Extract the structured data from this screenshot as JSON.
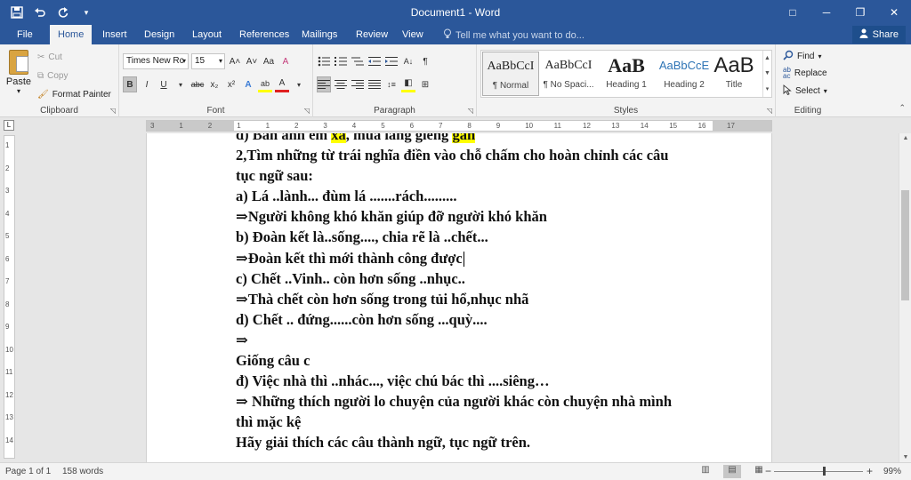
{
  "app": {
    "title": "Document1 - Word",
    "icons": {
      "save": "save-icon",
      "undo": "undo-icon",
      "redo": "redo-icon",
      "customize": "customize-qat-icon"
    }
  },
  "window": {
    "ribbon_display": "□",
    "minimize": "─",
    "restore": "❐",
    "close": "✕"
  },
  "tabs": [
    "File",
    "Home",
    "Insert",
    "Design",
    "Layout",
    "References",
    "Mailings",
    "Review",
    "View"
  ],
  "tell_me": "Tell me what you want to do...",
  "share": "Share",
  "ribbon": {
    "clipboard": {
      "paste": "Paste",
      "cut": "Cut",
      "copy": "Copy",
      "format_painter": "Format Painter",
      "label": "Clipboard"
    },
    "font": {
      "name": "Times New Rc",
      "size": "15",
      "grow": "A˄",
      "shrink": "A˅",
      "case": "Aa",
      "clear": "A",
      "bold": "B",
      "italic": "I",
      "underline": "U",
      "strike": "abc",
      "sub": "x₂",
      "sup": "x²",
      "effects": "A",
      "highlight": "ab",
      "color": "A",
      "label": "Font"
    },
    "paragraph": {
      "label": "Paragraph",
      "pilcrow": "¶"
    },
    "styles": {
      "label": "Styles",
      "items": [
        {
          "preview": "AaBbCcI",
          "name": "¶ Normal"
        },
        {
          "preview": "AaBbCcI",
          "name": "¶ No Spaci..."
        },
        {
          "preview": "AaB",
          "name": "Heading 1"
        },
        {
          "preview": "AaBbCcE",
          "name": "Heading 2"
        },
        {
          "preview": "AaB",
          "name": "Title"
        }
      ]
    },
    "editing": {
      "label": "Editing",
      "find": "Find",
      "replace": "Replace",
      "select": "Select"
    }
  },
  "ruler": {
    "ticks": [
      "3",
      "1",
      "2",
      "1",
      "1",
      "2",
      "3",
      "4",
      "5",
      "6",
      "7",
      "8",
      "9",
      "10",
      "11",
      "12",
      "13",
      "14",
      "15",
      "16",
      "17"
    ]
  },
  "vruler": {
    "ticks": [
      "1",
      "2",
      "3",
      "4",
      "5",
      "6",
      "7",
      "8",
      "9",
      "10",
      "11",
      "12",
      "13",
      "14"
    ]
  },
  "document": {
    "lines": [
      {
        "pre": "d) Bán anh em ",
        "hl": "xa",
        "post": ", mua láng giềng ",
        "hl2": "gần"
      },
      {
        "text": " 2,Tìm những từ trái nghĩa điền vào chỗ chấm cho hoàn chỉnh các câu"
      },
      {
        "text": "tục ngữ sau:"
      },
      {
        "text": "a) Lá ..lành... đùm lá .......rách........."
      },
      {
        "text": "⇒Người không khó khăn giúp đỡ người khó khăn"
      },
      {
        "text": "b) Đoàn kết là..sống...., chia rẽ là ..chết..."
      },
      {
        "text": "⇒Đoàn kết thì mới thành công được",
        "caret": true
      },
      {
        "text": "c) Chết ..Vinh.. còn hơn sống ..nhục.."
      },
      {
        "text": "⇒Thà chết còn hơn sống trong tủi hổ,nhục nhã"
      },
      {
        "text": " d) Chết .. đứng......còn hơn sống ...quỳ...."
      },
      {
        "text": "⇒"
      },
      {
        "text": "Giống câu c"
      },
      {
        "text": "đ) Việc nhà thì ..nhác..., việc chú bác thì ....siêng…"
      },
      {
        "text": "⇒ Những thích người lo chuyện của người khác còn chuyện nhà mình"
      },
      {
        "text": "thì mặc kệ"
      },
      {
        "text": "Hãy giải thích các câu thành ngữ, tục ngữ trên."
      }
    ]
  },
  "status": {
    "page": "Page 1 of 1",
    "words": "158 words",
    "zoom_minus": "−",
    "zoom_plus": "+",
    "zoom": "99%"
  },
  "colors": {
    "accent": "#2b579a",
    "highlight": "#ffff00"
  }
}
